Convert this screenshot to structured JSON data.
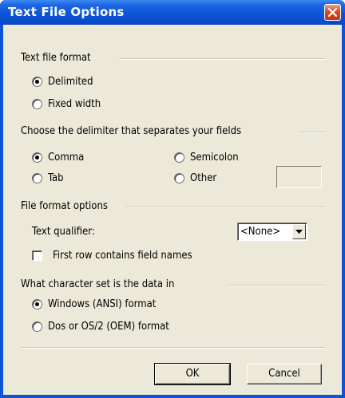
{
  "window": {
    "title": "Text File Options"
  },
  "text_file_format": {
    "label": "Text file format",
    "options": [
      "Delimited",
      "Fixed width"
    ],
    "selected": "Delimited"
  },
  "delimiter": {
    "label": "Choose the delimiter that separates your fields",
    "options": [
      "Comma",
      "Tab",
      "Semicolon",
      "Other"
    ],
    "selected": "Comma",
    "other_value": ""
  },
  "file_format_options": {
    "label": "File format options",
    "qualifier_label": "Text qualifier:",
    "qualifier_value": "<None>",
    "first_row_label": "First row contains field names",
    "first_row_checked": false
  },
  "character_set": {
    "label": "What character set is the data in",
    "options": [
      "Windows (ANSI) format",
      "Dos or OS/2 (OEM) format"
    ],
    "selected": "Windows (ANSI) format"
  },
  "buttons": {
    "ok": "OK",
    "cancel": "Cancel"
  },
  "icons": {
    "close": "close-icon",
    "dropdown": "chevron-down-icon"
  },
  "colors": {
    "titlebar": "#0a55d8",
    "client": "#ece9d8",
    "close": "#d9492a"
  }
}
